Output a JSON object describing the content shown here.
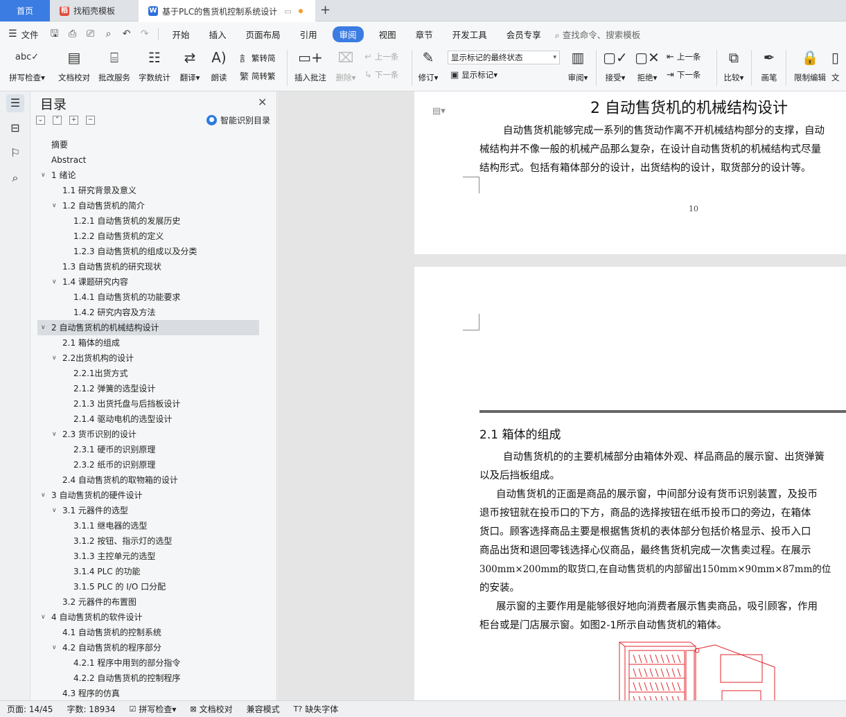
{
  "tabs": {
    "home": "首页",
    "template": "找稻壳模板",
    "doc": "基于PLC的售货机控制系统设计"
  },
  "menu": {
    "file": "文件",
    "items": [
      "开始",
      "插入",
      "页面布局",
      "引用",
      "审阅",
      "视图",
      "章节",
      "开发工具",
      "会员专享"
    ],
    "active": "审阅",
    "search": "查找命令、搜索模板"
  },
  "ribbon": {
    "spell_check": "拼写检查",
    "doc_proof": "文档校对",
    "batch_service": "批改服务",
    "word_count": "字数统计",
    "translate": "翻译",
    "read_aloud": "朗读",
    "to_traditional": "繁转简",
    "to_simplified": "简转繁",
    "insert_comment": "插入批注",
    "delete": "删除",
    "prev_comment": "上一条",
    "next_comment": "下一条",
    "revise": "修订",
    "markup_state": "显示标记的最终状态",
    "show_markup": "显示标记",
    "review": "审阅",
    "accept": "接受",
    "reject": "拒绝",
    "prev_change": "上一条",
    "next_change": "下一条",
    "compare": "比较",
    "pen": "画笔",
    "restrict_edit": "限制编辑",
    "doc_protect": "文"
  },
  "toc": {
    "title": "目录",
    "smart": "智能识别目录",
    "items": [
      {
        "label": "摘要",
        "level": 1,
        "toggle": false
      },
      {
        "label": "Abstract",
        "level": 1,
        "toggle": false
      },
      {
        "label": "1  绪论",
        "level": 1,
        "toggle": true
      },
      {
        "label": "1.1 研究背景及意义",
        "level": 2,
        "toggle": false
      },
      {
        "label": "1.2 自动售货机的简介",
        "level": 2,
        "toggle": true
      },
      {
        "label": "1.2.1 自动售货机的发展历史",
        "level": 3,
        "toggle": false
      },
      {
        "label": "1.2.2 自动售货机的定义",
        "level": 3,
        "toggle": false
      },
      {
        "label": "1.2.3 自动售货机的组成以及分类",
        "level": 3,
        "toggle": false
      },
      {
        "label": "1.3 自动售货机的研究现状",
        "level": 2,
        "toggle": false
      },
      {
        "label": "1.4 课题研究内容",
        "level": 2,
        "toggle": true
      },
      {
        "label": "1.4.1  自动售货机的功能要求",
        "level": 3,
        "toggle": false
      },
      {
        "label": "1.4.2 研究内容及方法",
        "level": 3,
        "toggle": false
      },
      {
        "label": "2 自动售货机的机械结构设计",
        "level": 1,
        "toggle": true,
        "selected": true
      },
      {
        "label": "2.1  箱体的组成",
        "level": 2,
        "toggle": false
      },
      {
        "label": "2.2出货机构的设计",
        "level": 2,
        "toggle": true
      },
      {
        "label": "2.2.1出货方式",
        "level": 3,
        "toggle": false
      },
      {
        "label": "2.1.2 弹簧的选型设计",
        "level": 3,
        "toggle": false
      },
      {
        "label": "2.1.3 出货托盘与后挡板设计",
        "level": 3,
        "toggle": false
      },
      {
        "label": "2.1.4 驱动电机的选型设计",
        "level": 3,
        "toggle": false
      },
      {
        "label": "2.3 货币识别的设计",
        "level": 2,
        "toggle": true
      },
      {
        "label": "2.3.1  硬币的识别原理",
        "level": 3,
        "toggle": false
      },
      {
        "label": "2.3.2  纸币的识别原理",
        "level": 3,
        "toggle": false
      },
      {
        "label": "2.4 自动售货机的取物箱的设计",
        "level": 2,
        "toggle": false
      },
      {
        "label": "3 自动售货机的硬件设计",
        "level": 1,
        "toggle": true
      },
      {
        "label": "3.1 元器件的选型",
        "level": 2,
        "toggle": true
      },
      {
        "label": "3.1.1 继电器的选型",
        "level": 3,
        "toggle": false
      },
      {
        "label": "3.1.2 按钮、指示灯的选型",
        "level": 3,
        "toggle": false
      },
      {
        "label": "3.1.3 主控单元的选型",
        "level": 3,
        "toggle": false
      },
      {
        "label": "3.1.4 PLC 的功能",
        "level": 3,
        "toggle": false
      },
      {
        "label": "3.1.5 PLC 的 I/O 口分配",
        "level": 3,
        "toggle": false
      },
      {
        "label": "3.2 元器件的布置图",
        "level": 2,
        "toggle": false
      },
      {
        "label": "4  自动售货机的软件设计",
        "level": 1,
        "toggle": true
      },
      {
        "label": "4.1  自动售货机的控制系统",
        "level": 2,
        "toggle": false
      },
      {
        "label": "4.2  自动售货机的程序部分",
        "level": 2,
        "toggle": true
      },
      {
        "label": "4.2.1  程序中用到的部分指令",
        "level": 3,
        "toggle": false
      },
      {
        "label": "4.2.2  自动售货机的控制程序",
        "level": 3,
        "toggle": false
      },
      {
        "label": "4.3  程序的仿真",
        "level": 2,
        "toggle": false
      }
    ]
  },
  "document": {
    "chapter_title": "2 自动售货机的机械结构设计",
    "intro_lines": [
      "自动售货机能够完成一系列的售货动作离不开机械结构部分的支撑，自动",
      "械结构并不像一般的机械产品那么复杂，在设计自动售货机的机械结构式尽量",
      "结构形式。包括有箱体部分的设计，出货结构的设计，取货部分的设计等。"
    ],
    "page_number": "10",
    "section_title": "2.1  箱体的组成",
    "section_lines": [
      "自动售货机的的主要机械部分由箱体外观、样品商品的展示窗、出货弹簧",
      "以及后挡板组成。",
      "自动售货机的正面是商品的展示窗，中间部分设有货币识别装置，及投币",
      "退币按钮就在投币口的下方，商品的选择按钮在纸币投币口的旁边，在箱体",
      "货口。顾客选择商品主要是根据售货机的表体部分包括价格显示、投币入口",
      "商品出货和退回零钱选择心仪商品，最终售货机完成一次售卖过程。在展示",
      "300mm×200mm的取货口,在自动售货机的内部留出150mm×90mm×87mm的位",
      "的安装。",
      "展示窗的主要作用是能够很好地向消费者展示售卖商品，吸引顾客，作用",
      "柜台或是门店展示窗。如图2-1所示自动售货机的箱体。"
    ]
  },
  "status": {
    "page": "页面: 14/45",
    "words": "字数: 18934",
    "spell": "拼写检查",
    "proof": "文档校对",
    "compat": "兼容模式",
    "missing_font": "缺失字体"
  },
  "colors": {
    "accent": "#3a7ce2",
    "drawing": "#e0262b"
  }
}
